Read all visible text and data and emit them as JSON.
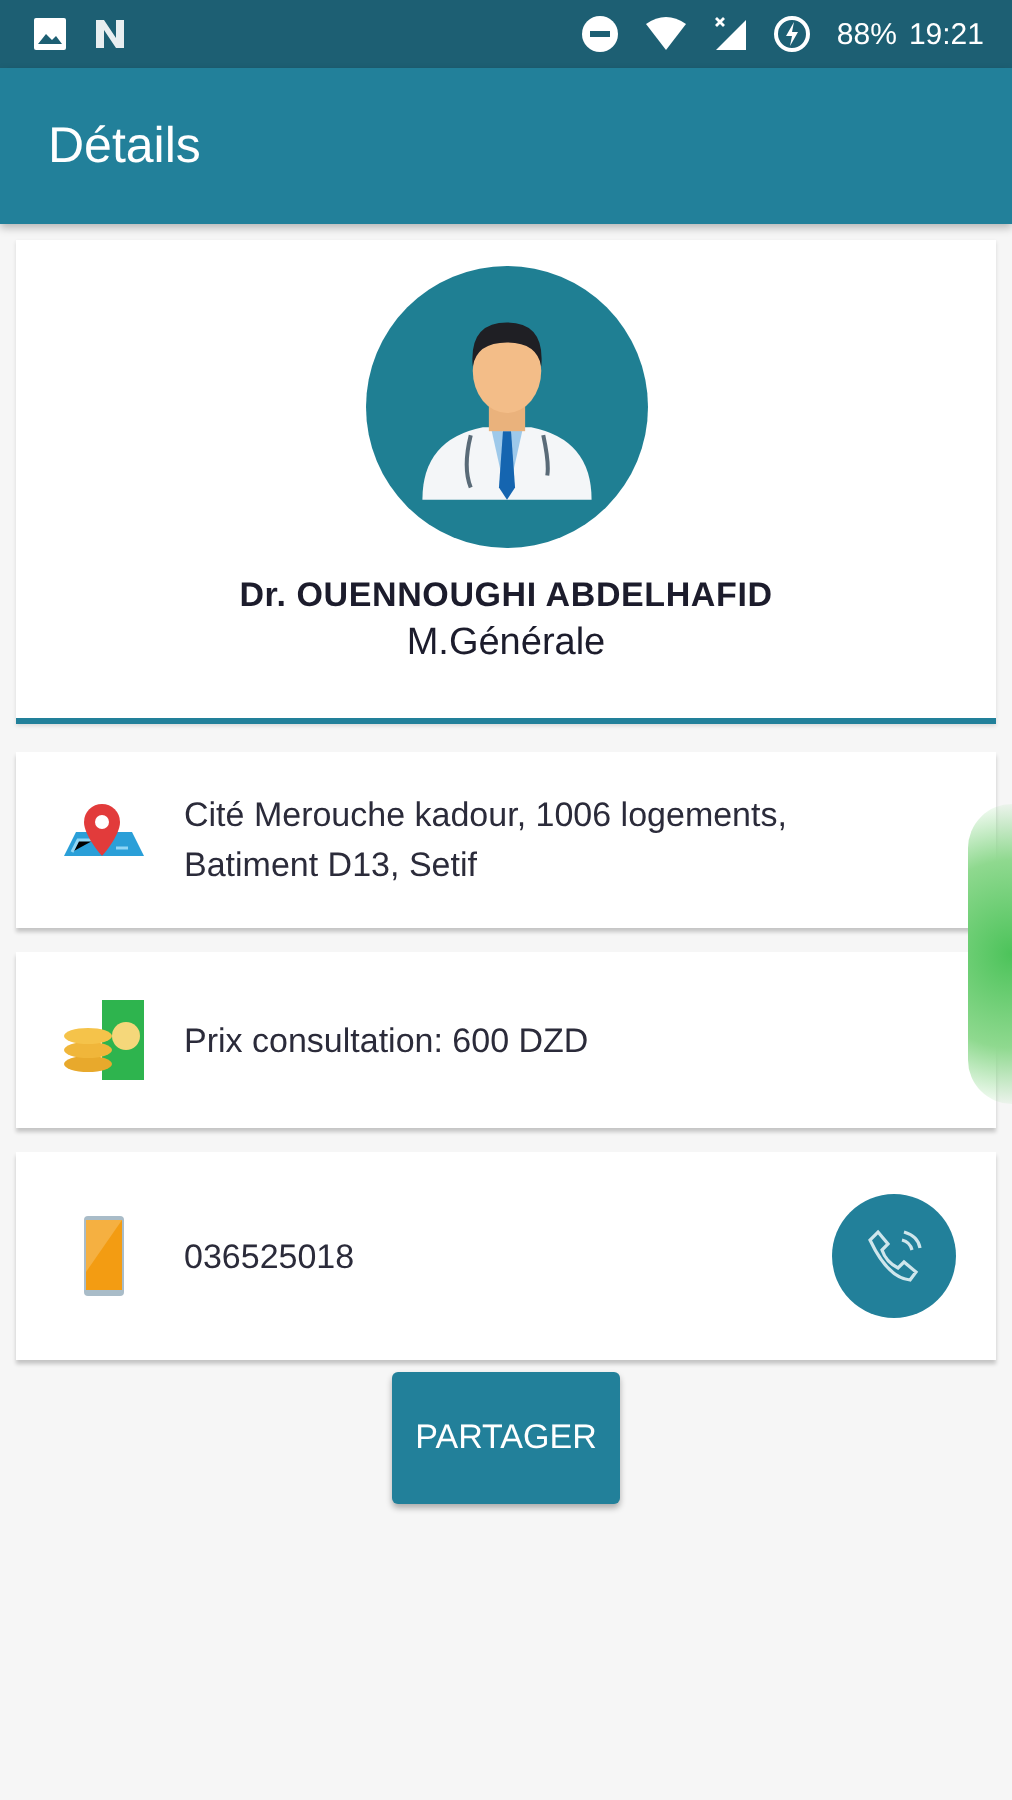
{
  "status_bar": {
    "battery": "88%",
    "time": "19:21"
  },
  "app_bar": {
    "title": "Détails"
  },
  "doctor": {
    "name": "Dr. OUENNOUGHI ABDELHAFID",
    "specialty": "M.Générale"
  },
  "info": [
    {
      "kind": "address",
      "text": "Cité Merouche kadour, 1006 logements, Batiment D13, Setif"
    },
    {
      "kind": "price",
      "text": "Prix consultation: 600 DZD"
    },
    {
      "kind": "phone",
      "text": "036525018",
      "call_button": true
    }
  ],
  "share_button": "PARTAGER"
}
